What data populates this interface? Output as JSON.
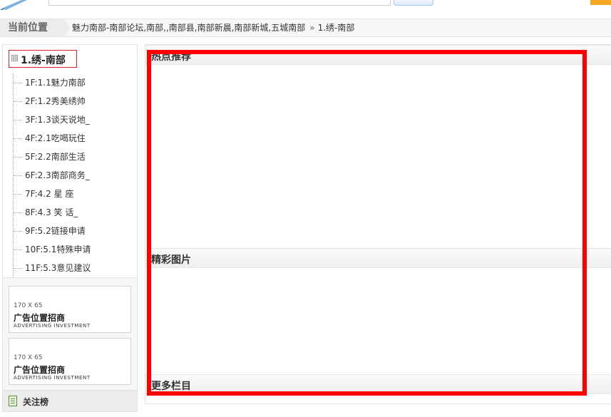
{
  "breadcrumb": {
    "title": "当前位置",
    "path": "魅力南部-南部论坛,南部,,南部县,南部新晨,南部新城,五城南部",
    "separator": "»",
    "current": "1.绣-南部"
  },
  "sidebar": {
    "toggle_symbol": "⊟",
    "forum_title": "1.绣-南部",
    "items": [
      "1F:1.1魅力南部",
      "2F:1.2秀美绣帅",
      "3F:1.3谈天说地_",
      "4F:2.1吃喝玩住",
      "5F:2.2南部生活",
      "6F:2.3南部商务_",
      "7F:4.2 星 座",
      "8F:4.3 笑 话_",
      "9F:5.2链接申请",
      "10F:5.1特殊申请",
      "11F:5.3意见建议"
    ],
    "ads": [
      {
        "size": "170 X 65",
        "title": "广告位置招商",
        "subtitle": "ADVERTISING INVESTMENT"
      },
      {
        "size": "170 X 65",
        "title": "广告位置招商",
        "subtitle": "ADVERTISING INVESTMENT"
      }
    ],
    "focus_label": "关注榜"
  },
  "main": {
    "sections": [
      {
        "title": "热点推荐"
      },
      {
        "title": "精彩图片"
      },
      {
        "title": "更多栏目"
      }
    ]
  },
  "colors": {
    "highlight": "#ff0000",
    "forum_head_border": "#d8232a",
    "accent_orange": "#f7a823"
  }
}
